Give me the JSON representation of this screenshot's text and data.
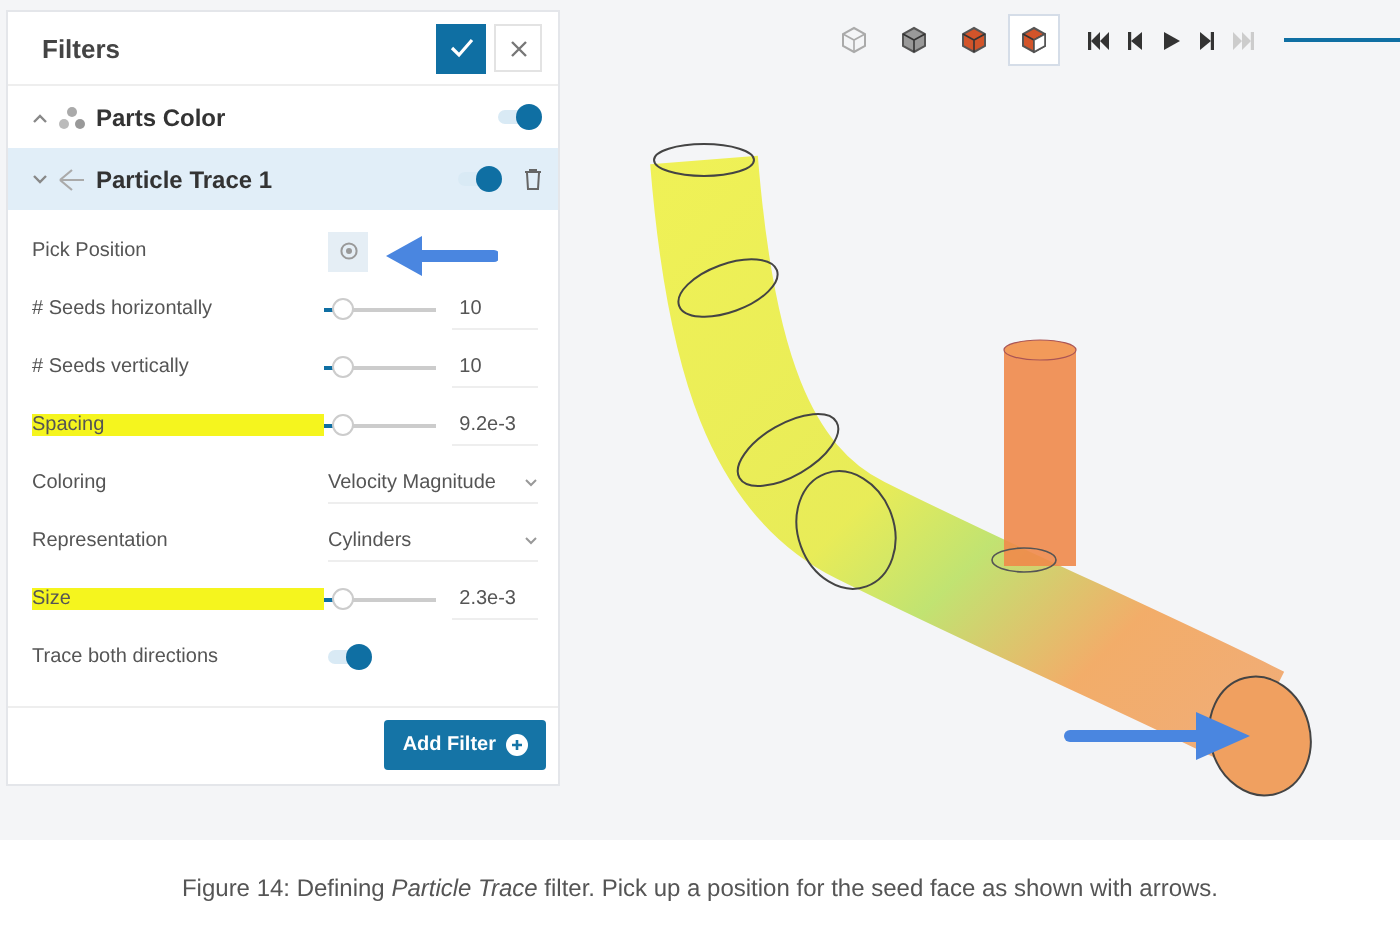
{
  "panel": {
    "title": "Filters",
    "filters": [
      {
        "label": "Parts Color",
        "expanded": false,
        "selected": false,
        "on": true
      },
      {
        "label": "Particle Trace 1",
        "expanded": true,
        "selected": true,
        "on": true
      }
    ],
    "params": [
      {
        "kind": "pick",
        "label": "Pick Position",
        "highlighted": false
      },
      {
        "kind": "slider",
        "label": "# Seeds horizontally",
        "highlighted": false,
        "level": 0.15,
        "value": "10"
      },
      {
        "kind": "slider",
        "label": "# Seeds vertically",
        "highlighted": false,
        "level": 0.15,
        "value": "10"
      },
      {
        "kind": "slider",
        "label": "Spacing",
        "highlighted": true,
        "level": 0.15,
        "value": "9.2e-3"
      },
      {
        "kind": "select",
        "label": "Coloring",
        "highlighted": false,
        "value": "Velocity Magnitude"
      },
      {
        "kind": "select",
        "label": "Representation",
        "highlighted": false,
        "value": "Cylinders"
      },
      {
        "kind": "slider",
        "label": "Size",
        "highlighted": true,
        "level": 0.15,
        "value": "2.3e-3"
      },
      {
        "kind": "toggle",
        "label": "Trace both directions",
        "highlighted": false,
        "on": true
      }
    ],
    "add_button": "Add Filter"
  },
  "toolbar": {
    "views": [
      {
        "selected": false
      },
      {
        "selected": false
      },
      {
        "selected": false
      },
      {
        "selected": true
      }
    ],
    "timeline": {
      "level": 1
    },
    "playback": [
      {
        "disabled": false
      },
      {
        "disabled": false
      },
      {
        "disabled": false
      },
      {
        "disabled": false
      },
      {
        "disabled": true
      }
    ]
  },
  "caption": "Figure 14: Defining *Particle Trace* filter. Pick up a position for the seed face as shown with arrows."
}
